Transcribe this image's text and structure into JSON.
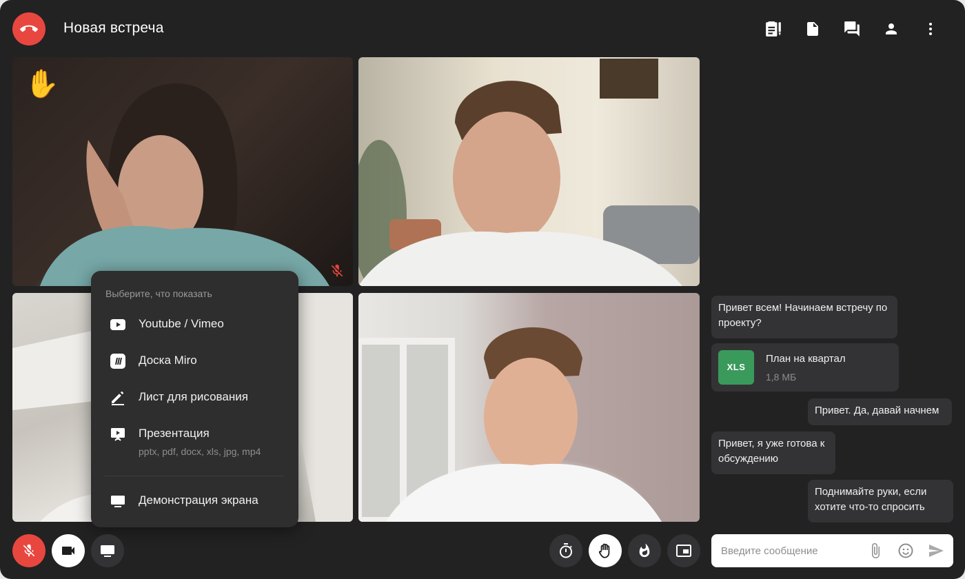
{
  "header": {
    "title": "Новая встреча",
    "icons": [
      "tasks-icon",
      "document-icon",
      "chat-icon",
      "participants-icon",
      "more-icon"
    ]
  },
  "colors": {
    "background": "#222223",
    "accent_red": "#e8473f",
    "panel": "#333335",
    "xls_green": "#3a9a5c"
  },
  "tiles": [
    {
      "name": "participant-1",
      "raised_hand": true,
      "muted": true
    },
    {
      "name": "participant-2"
    },
    {
      "name": "participant-3"
    },
    {
      "name": "participant-4"
    }
  ],
  "share_menu": {
    "heading": "Выберите, что показать",
    "items": [
      {
        "icon": "youtube-icon",
        "label": "Youtube / Vimeo"
      },
      {
        "icon": "miro-icon",
        "label": "Доска Miro"
      },
      {
        "icon": "pencil-icon",
        "label": "Лист для рисования"
      },
      {
        "icon": "presentation-icon",
        "label": "Презентация",
        "sub": "pptx, pdf, docx, xls, jpg, mp4"
      },
      {
        "icon": "monitor-icon",
        "label": "Демонстрация экрана"
      }
    ]
  },
  "controls": {
    "left": [
      "mic-off-icon",
      "camera-icon",
      "screen-share-icon"
    ],
    "right": [
      "timer-icon",
      "raise-hand-icon",
      "fire-icon",
      "picture-in-picture-icon"
    ]
  },
  "chat": {
    "messages": [
      {
        "text": "Привет всем! Начинаем встречу по проекту?",
        "side": "left"
      },
      {
        "file": {
          "type": "XLS",
          "name": "План на квартал",
          "size": "1,8 МБ"
        },
        "side": "left"
      },
      {
        "text": "Привет. Да, давай начнем",
        "side": "right"
      },
      {
        "text": "Привет, я уже готова к обсуждению",
        "side": "left"
      },
      {
        "text": "Поднимайте руки, если хотите что-то спросить",
        "side": "right"
      }
    ],
    "input": {
      "placeholder": "Введите сообщение",
      "value": ""
    }
  }
}
